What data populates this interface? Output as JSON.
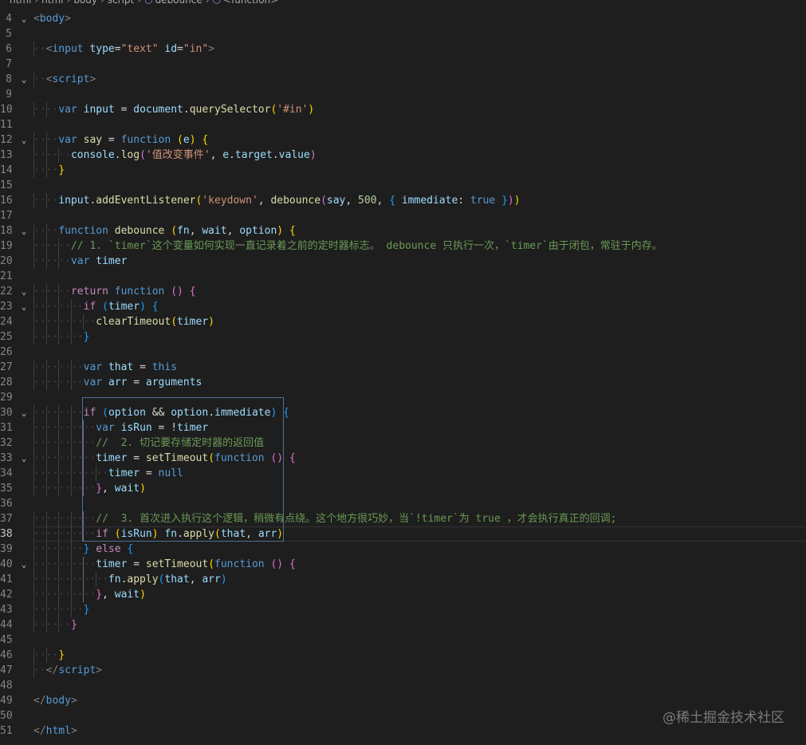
{
  "breadcrumb": [
    "html",
    "html",
    "body",
    "script",
    "debounce",
    "<function>"
  ],
  "watermark": "@稀土掘金技术社区",
  "colors": {
    "background": "#1e1e1e",
    "line_number": "#858585",
    "tag": "#569cd6",
    "attribute": "#9cdcfe",
    "string": "#ce9178",
    "keyword": "#569cd6",
    "control": "#c586c0",
    "function": "#dcdcaa",
    "number": "#b5cea8",
    "comment": "#6a9955",
    "bracket_1": "#ffd700",
    "bracket_2": "#da70d6",
    "bracket_3": "#179fff"
  },
  "editor": {
    "current_line": 38,
    "lines": [
      {
        "n": 4,
        "fold": true,
        "ind": 0,
        "tk": [
          [
            "b",
            "<"
          ],
          [
            "tag",
            "body"
          ],
          [
            "b",
            ">"
          ]
        ]
      },
      {
        "n": 5,
        "ind": 0,
        "tk": []
      },
      {
        "n": 6,
        "ind": 1,
        "tk": [
          [
            "b",
            "<"
          ],
          [
            "tag",
            "input"
          ],
          [
            "p",
            " "
          ],
          [
            "attr",
            "type"
          ],
          [
            "p",
            "="
          ],
          [
            "str",
            "\"text\""
          ],
          [
            "p",
            " "
          ],
          [
            "attr",
            "id"
          ],
          [
            "p",
            "="
          ],
          [
            "str",
            "\"in\""
          ],
          [
            "b",
            ">"
          ]
        ]
      },
      {
        "n": 7,
        "ind": 0,
        "tk": []
      },
      {
        "n": 8,
        "fold": true,
        "ind": 1,
        "tk": [
          [
            "b",
            "<"
          ],
          [
            "tag",
            "script"
          ],
          [
            "b",
            ">"
          ]
        ]
      },
      {
        "n": 9,
        "ind": 0,
        "tk": []
      },
      {
        "n": 10,
        "ind": 2,
        "tk": [
          [
            "kw",
            "var"
          ],
          [
            "p",
            " "
          ],
          [
            "var",
            "input"
          ],
          [
            "p",
            " = "
          ],
          [
            "var",
            "document"
          ],
          [
            "p",
            "."
          ],
          [
            "fn",
            "querySelector"
          ],
          [
            "b1",
            "("
          ],
          [
            "str",
            "'#in'"
          ],
          [
            "b1",
            ")"
          ]
        ]
      },
      {
        "n": 11,
        "ind": 0,
        "tk": []
      },
      {
        "n": 12,
        "fold": true,
        "ind": 2,
        "tk": [
          [
            "kw",
            "var"
          ],
          [
            "p",
            " "
          ],
          [
            "fn",
            "say"
          ],
          [
            "p",
            " = "
          ],
          [
            "kw",
            "function"
          ],
          [
            "p",
            " "
          ],
          [
            "b1",
            "("
          ],
          [
            "var",
            "e"
          ],
          [
            "b1",
            ")"
          ],
          [
            "p",
            " "
          ],
          [
            "b1",
            "{"
          ]
        ]
      },
      {
        "n": 13,
        "ind": 3,
        "tk": [
          [
            "var",
            "console"
          ],
          [
            "p",
            "."
          ],
          [
            "fn",
            "log"
          ],
          [
            "b2",
            "("
          ],
          [
            "str",
            "'值改变事件'"
          ],
          [
            "p",
            ", "
          ],
          [
            "var",
            "e"
          ],
          [
            "p",
            "."
          ],
          [
            "var",
            "target"
          ],
          [
            "p",
            "."
          ],
          [
            "var",
            "value"
          ],
          [
            "b2",
            ")"
          ]
        ]
      },
      {
        "n": 14,
        "ind": 2,
        "tk": [
          [
            "b1",
            "}"
          ]
        ]
      },
      {
        "n": 15,
        "ind": 0,
        "tk": []
      },
      {
        "n": 16,
        "ind": 2,
        "tk": [
          [
            "var",
            "input"
          ],
          [
            "p",
            "."
          ],
          [
            "fn",
            "addEventListener"
          ],
          [
            "b1",
            "("
          ],
          [
            "str",
            "'keydown'"
          ],
          [
            "p",
            ", "
          ],
          [
            "fn",
            "debounce"
          ],
          [
            "b2",
            "("
          ],
          [
            "var",
            "say"
          ],
          [
            "p",
            ", "
          ],
          [
            "num",
            "500"
          ],
          [
            "p",
            ", "
          ],
          [
            "b3",
            "{"
          ],
          [
            "p",
            " "
          ],
          [
            "var",
            "immediate"
          ],
          [
            "p",
            ": "
          ],
          [
            "kw",
            "true"
          ],
          [
            "p",
            " "
          ],
          [
            "b3",
            "}"
          ],
          [
            "b2",
            ")"
          ],
          [
            "b1",
            ")"
          ]
        ]
      },
      {
        "n": 17,
        "ind": 0,
        "tk": []
      },
      {
        "n": 18,
        "fold": true,
        "ind": 2,
        "tk": [
          [
            "kw",
            "function"
          ],
          [
            "p",
            " "
          ],
          [
            "fn",
            "debounce"
          ],
          [
            "p",
            " "
          ],
          [
            "b1",
            "("
          ],
          [
            "var",
            "fn"
          ],
          [
            "p",
            ", "
          ],
          [
            "var",
            "wait"
          ],
          [
            "p",
            ", "
          ],
          [
            "var",
            "option"
          ],
          [
            "b1",
            ")"
          ],
          [
            "p",
            " "
          ],
          [
            "b1",
            "{"
          ]
        ]
      },
      {
        "n": 19,
        "ind": 3,
        "tk": [
          [
            "com",
            "// 1. `timer`这个变量如何实现一直记录着之前的定时器标志。 debounce 只执行一次，`timer`由于闭包，常驻于内存。"
          ]
        ]
      },
      {
        "n": 20,
        "ind": 3,
        "tk": [
          [
            "kw",
            "var"
          ],
          [
            "p",
            " "
          ],
          [
            "var",
            "timer"
          ]
        ]
      },
      {
        "n": 21,
        "ind": 0,
        "tk": []
      },
      {
        "n": 22,
        "fold": true,
        "ind": 3,
        "tk": [
          [
            "ctl",
            "return"
          ],
          [
            "p",
            " "
          ],
          [
            "kw",
            "function"
          ],
          [
            "p",
            " "
          ],
          [
            "b2",
            "("
          ],
          [
            "b2",
            ")"
          ],
          [
            "p",
            " "
          ],
          [
            "b2",
            "{"
          ]
        ]
      },
      {
        "n": 23,
        "fold": true,
        "ind": 4,
        "tk": [
          [
            "ctl",
            "if"
          ],
          [
            "p",
            " "
          ],
          [
            "b3",
            "("
          ],
          [
            "var",
            "timer"
          ],
          [
            "b3",
            ")"
          ],
          [
            "p",
            " "
          ],
          [
            "b3",
            "{"
          ]
        ]
      },
      {
        "n": 24,
        "ind": 5,
        "tk": [
          [
            "fn",
            "clearTimeout"
          ],
          [
            "b1",
            "("
          ],
          [
            "var",
            "timer"
          ],
          [
            "b1",
            ")"
          ]
        ]
      },
      {
        "n": 25,
        "ind": 4,
        "tk": [
          [
            "b3",
            "}"
          ]
        ]
      },
      {
        "n": 26,
        "ind": 0,
        "tk": []
      },
      {
        "n": 27,
        "ind": 4,
        "tk": [
          [
            "kw",
            "var"
          ],
          [
            "p",
            " "
          ],
          [
            "var",
            "that"
          ],
          [
            "p",
            " = "
          ],
          [
            "kw",
            "this"
          ]
        ]
      },
      {
        "n": 28,
        "ind": 4,
        "tk": [
          [
            "kw",
            "var"
          ],
          [
            "p",
            " "
          ],
          [
            "var",
            "arr"
          ],
          [
            "p",
            " = "
          ],
          [
            "var",
            "arguments"
          ]
        ]
      },
      {
        "n": 29,
        "ind": 0,
        "tk": []
      },
      {
        "n": 30,
        "fold": true,
        "ind": 4,
        "tk": [
          [
            "ctl",
            "if"
          ],
          [
            "p",
            " "
          ],
          [
            "b3",
            "("
          ],
          [
            "var",
            "option"
          ],
          [
            "p",
            " && "
          ],
          [
            "var",
            "option"
          ],
          [
            "p",
            "."
          ],
          [
            "var",
            "immediate"
          ],
          [
            "b3",
            ")"
          ],
          [
            "p",
            " "
          ],
          [
            "b3",
            "{"
          ]
        ]
      },
      {
        "n": 31,
        "ind": 5,
        "tk": [
          [
            "kw",
            "var"
          ],
          [
            "p",
            " "
          ],
          [
            "var",
            "isRun"
          ],
          [
            "p",
            " = !"
          ],
          [
            "var",
            "timer"
          ]
        ]
      },
      {
        "n": 32,
        "ind": 5,
        "tk": [
          [
            "com",
            "//  2. 切记要存储定时器的返回值"
          ]
        ]
      },
      {
        "n": 33,
        "fold": true,
        "ind": 5,
        "tk": [
          [
            "var",
            "timer"
          ],
          [
            "p",
            " = "
          ],
          [
            "fn",
            "setTimeout"
          ],
          [
            "b1",
            "("
          ],
          [
            "kw",
            "function"
          ],
          [
            "p",
            " "
          ],
          [
            "b2",
            "("
          ],
          [
            "b2",
            ")"
          ],
          [
            "p",
            " "
          ],
          [
            "b2",
            "{"
          ]
        ]
      },
      {
        "n": 34,
        "ind": 6,
        "tk": [
          [
            "var",
            "timer"
          ],
          [
            "p",
            " = "
          ],
          [
            "kw",
            "null"
          ]
        ]
      },
      {
        "n": 35,
        "ind": 5,
        "tk": [
          [
            "b2",
            "}"
          ],
          [
            "p",
            ", "
          ],
          [
            "var",
            "wait"
          ],
          [
            "b1",
            ")"
          ]
        ]
      },
      {
        "n": 36,
        "ind": 0,
        "tk": []
      },
      {
        "n": 37,
        "ind": 5,
        "tk": [
          [
            "com",
            "//  3. 首次进入执行这个逻辑，稍微有点绕。这个地方很巧妙，当`!timer`为 true ，才会执行真正的回调;"
          ]
        ]
      },
      {
        "n": 38,
        "ind": 5,
        "tk": [
          [
            "ctl",
            "if"
          ],
          [
            "p",
            " "
          ],
          [
            "b1",
            "("
          ],
          [
            "var",
            "isRun"
          ],
          [
            "b1",
            ")"
          ],
          [
            "p",
            " "
          ],
          [
            "var",
            "fn"
          ],
          [
            "p",
            "."
          ],
          [
            "fn",
            "apply"
          ],
          [
            "b1",
            "("
          ],
          [
            "var",
            "that"
          ],
          [
            "p",
            ", "
          ],
          [
            "var",
            "arr"
          ],
          [
            "b1",
            ")"
          ]
        ]
      },
      {
        "n": 39,
        "ind": 4,
        "tk": [
          [
            "b3",
            "}"
          ],
          [
            "p",
            " "
          ],
          [
            "ctl",
            "else"
          ],
          [
            "p",
            " "
          ],
          [
            "b3",
            "{"
          ]
        ]
      },
      {
        "n": 40,
        "fold": true,
        "ind": 5,
        "tk": [
          [
            "var",
            "timer"
          ],
          [
            "p",
            " = "
          ],
          [
            "fn",
            "setTimeout"
          ],
          [
            "b1",
            "("
          ],
          [
            "kw",
            "function"
          ],
          [
            "p",
            " "
          ],
          [
            "b2",
            "("
          ],
          [
            "b2",
            ")"
          ],
          [
            "p",
            " "
          ],
          [
            "b2",
            "{"
          ]
        ]
      },
      {
        "n": 41,
        "ind": 6,
        "tk": [
          [
            "var",
            "fn"
          ],
          [
            "p",
            "."
          ],
          [
            "fn",
            "apply"
          ],
          [
            "b3",
            "("
          ],
          [
            "var",
            "that"
          ],
          [
            "p",
            ", "
          ],
          [
            "var",
            "arr"
          ],
          [
            "b3",
            ")"
          ]
        ]
      },
      {
        "n": 42,
        "ind": 5,
        "tk": [
          [
            "b2",
            "}"
          ],
          [
            "p",
            ", "
          ],
          [
            "var",
            "wait"
          ],
          [
            "b1",
            ")"
          ]
        ]
      },
      {
        "n": 43,
        "ind": 4,
        "tk": [
          [
            "b3",
            "}"
          ]
        ]
      },
      {
        "n": 44,
        "ind": 3,
        "tk": [
          [
            "b2",
            "}"
          ]
        ]
      },
      {
        "n": 45,
        "ind": 0,
        "tk": []
      },
      {
        "n": 46,
        "ind": 2,
        "tk": [
          [
            "b1",
            "}"
          ]
        ]
      },
      {
        "n": 47,
        "ind": 1,
        "tk": [
          [
            "b",
            "</"
          ],
          [
            "tag",
            "script"
          ],
          [
            "b",
            ">"
          ]
        ]
      },
      {
        "n": 48,
        "ind": 0,
        "tk": []
      },
      {
        "n": 49,
        "ind": 0,
        "tk": [
          [
            "b",
            "</"
          ],
          [
            "tag",
            "body"
          ],
          [
            "b",
            ">"
          ]
        ]
      },
      {
        "n": 50,
        "ind": 0,
        "tk": []
      },
      {
        "n": 51,
        "ind": 0,
        "tk": [
          [
            "b",
            "</"
          ],
          [
            "tag",
            "html"
          ],
          [
            "b",
            ">"
          ]
        ]
      }
    ]
  }
}
